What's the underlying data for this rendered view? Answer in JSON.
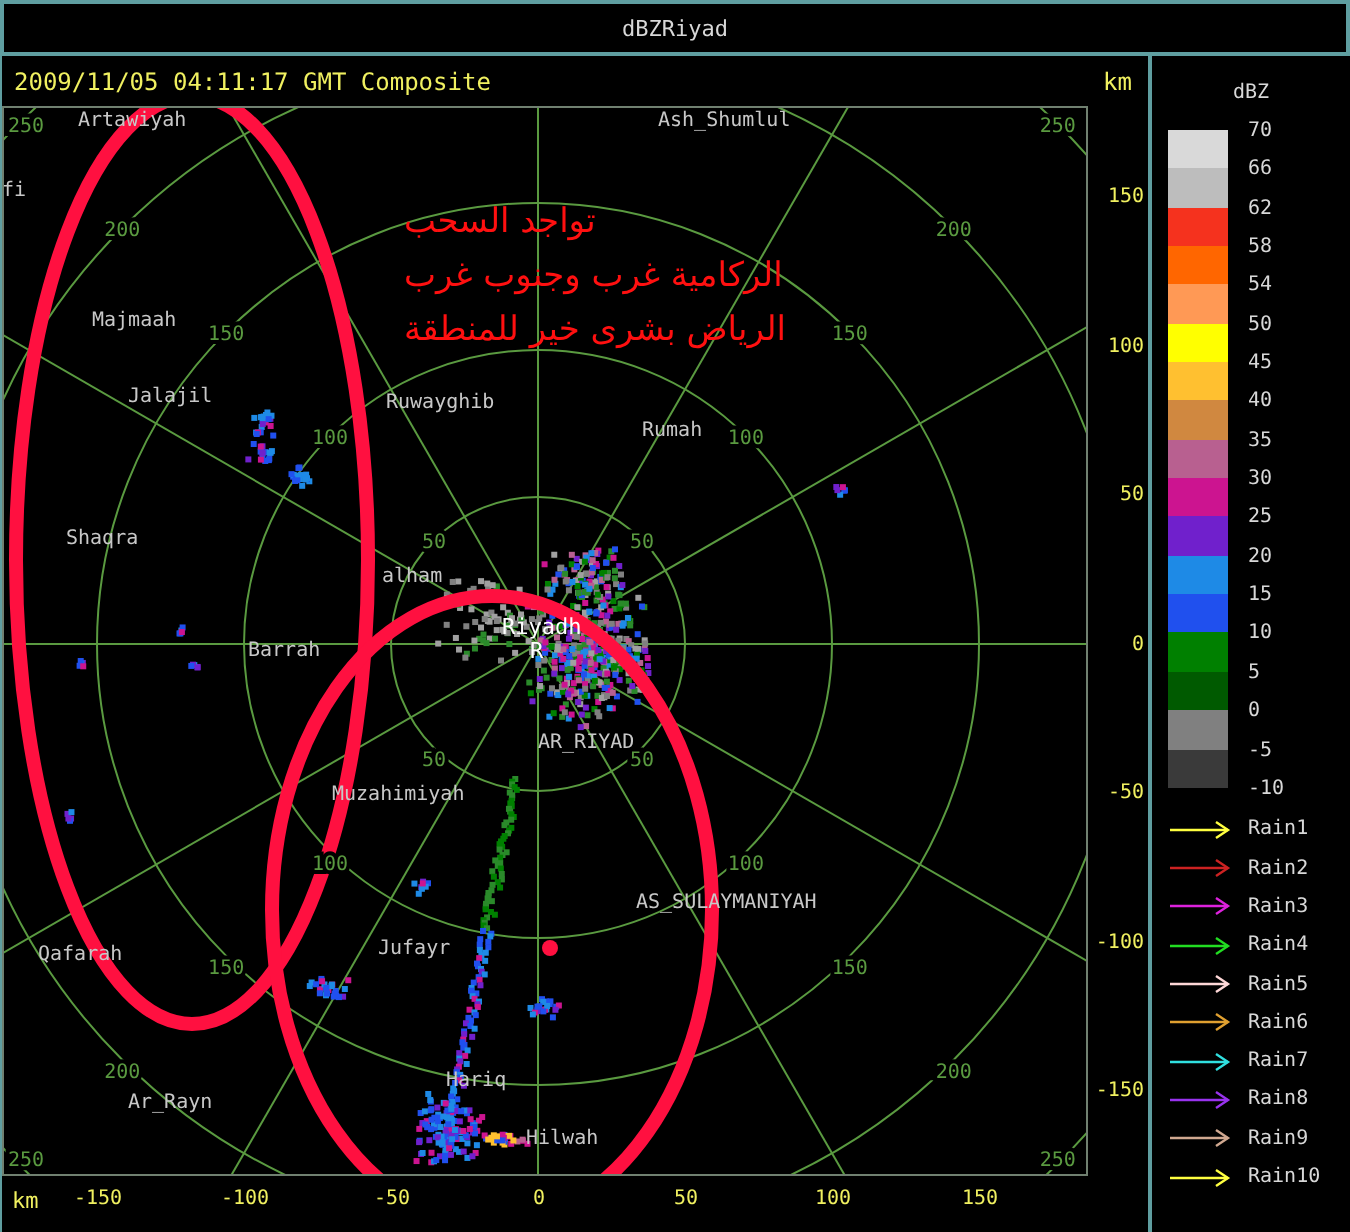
{
  "window": {
    "title": "dBZRiyad"
  },
  "header": {
    "timestamp": "2009/11/05 04:11:17 GMT Composite",
    "unit": "km"
  },
  "map": {
    "range_rings": [
      {
        "labels": [
          "50",
          "50",
          "50",
          "50"
        ]
      },
      {
        "labels": [
          "100",
          "100",
          "100",
          "100"
        ]
      },
      {
        "labels": [
          "150",
          "150",
          "150",
          "150"
        ]
      },
      {
        "labels": [
          "200",
          "200",
          "200",
          "200"
        ]
      },
      {
        "labels": [
          "250",
          "250",
          "250",
          "250"
        ]
      }
    ],
    "places": [
      {
        "name": "Artawiyah"
      },
      {
        "name": "Ash_Shumlul"
      },
      {
        "name": "fi"
      },
      {
        "name": "Majmaah"
      },
      {
        "name": "Jalajil"
      },
      {
        "name": "Ruwayghib"
      },
      {
        "name": "Rumah"
      },
      {
        "name": "Shaqra"
      },
      {
        "name": "alham"
      },
      {
        "name": "Barrah"
      },
      {
        "name": "AR_RIYAD"
      },
      {
        "name": "Muzahimiyah"
      },
      {
        "name": "AS_SULAYMANIYAH"
      },
      {
        "name": "Jufayr"
      },
      {
        "name": "Qafarah"
      },
      {
        "name": "Ar_Rayn"
      },
      {
        "name": "Hariq"
      },
      {
        "name": "Hilwah"
      }
    ],
    "site": {
      "name": "Riyadh",
      "marker": "R"
    },
    "annotation": [
      "تواجد السحب",
      "الركامية غرب وجنوب غرب",
      "الرياض بشرى خير للمنطقة"
    ]
  },
  "y_axis": {
    "ticks": [
      "150",
      "100",
      "50",
      "0",
      "-50",
      "-100",
      "-150"
    ]
  },
  "x_axis": {
    "unit": "km",
    "ticks": [
      "-150",
      "-100",
      "-50",
      "0",
      "50",
      "100",
      "150"
    ]
  },
  "legend": {
    "title": "dBZ",
    "bands": [
      {
        "color": "#d9d9d9"
      },
      {
        "color": "#bdbdbd"
      },
      {
        "color": "#f5321e"
      },
      {
        "color": "#ff6600"
      },
      {
        "color": "#ff9955"
      },
      {
        "color": "#ffff00"
      },
      {
        "color": "#ffc030"
      },
      {
        "color": "#d08840"
      },
      {
        "color": "#b86090"
      },
      {
        "color": "#cc1490"
      },
      {
        "color": "#7020cc"
      },
      {
        "color": "#1e8ae6"
      },
      {
        "color": "#2050ee"
      },
      {
        "color": "#008000"
      },
      {
        "color": "#005a00"
      },
      {
        "color": "#808080"
      },
      {
        "color": "#3a3a3a"
      }
    ],
    "ticks": [
      "70",
      "66",
      "62",
      "58",
      "54",
      "50",
      "45",
      "40",
      "35",
      "30",
      "25",
      "20",
      "15",
      "10",
      "5",
      "0",
      "-5",
      "-10"
    ],
    "series": [
      {
        "label": "Rain1",
        "color": "#ffff40"
      },
      {
        "label": "Rain2",
        "color": "#cc2222"
      },
      {
        "label": "Rain3",
        "color": "#dd22dd"
      },
      {
        "label": "Rain4",
        "color": "#22dd22"
      },
      {
        "label": "Rain5",
        "color": "#ffd8d8"
      },
      {
        "label": "Rain6",
        "color": "#e0a030"
      },
      {
        "label": "Rain7",
        "color": "#30e0e0"
      },
      {
        "label": "Rain8",
        "color": "#9933ee"
      },
      {
        "label": "Rain9",
        "color": "#d0a890"
      },
      {
        "label": "Rain10",
        "color": "#ffff40"
      }
    ]
  }
}
